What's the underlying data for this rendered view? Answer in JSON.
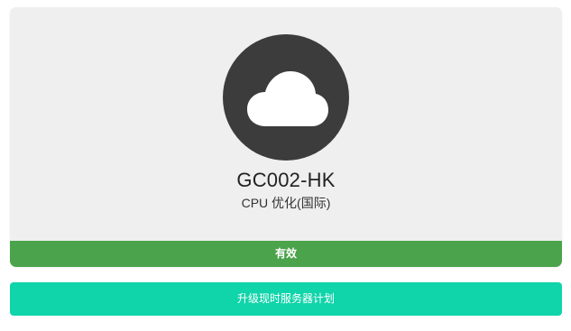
{
  "server": {
    "name": "GC002-HK",
    "type": "CPU 优化(国际)",
    "status": "有效",
    "icon": "cloud-icon"
  },
  "actions": {
    "upgrade_label": "升级现时服务器计划"
  },
  "colors": {
    "card_background": "#efefef",
    "icon_circle": "#3c3c3c",
    "status_green": "#4ba34b",
    "button_teal": "#10d4aa"
  }
}
